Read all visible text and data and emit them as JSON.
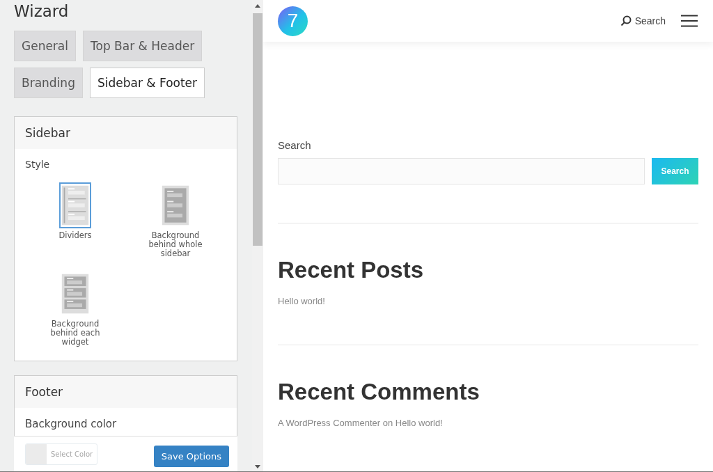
{
  "wizard": {
    "title": "Wizard",
    "tabs": [
      {
        "label": "General",
        "selected": false
      },
      {
        "label": "Top Bar & Header",
        "selected": false
      },
      {
        "label": "Branding",
        "selected": false
      },
      {
        "label": "Sidebar & Footer",
        "selected": true
      }
    ],
    "sidebar": {
      "title": "Sidebar",
      "style_label": "Style",
      "options": [
        {
          "kind": "dividers",
          "label": "Dividers",
          "selected": true
        },
        {
          "kind": "whole",
          "label": "Background behind whole sidebar",
          "selected": false
        },
        {
          "kind": "widget",
          "label": "Background behind each widget",
          "selected": false
        }
      ]
    },
    "footer": {
      "title": "Footer",
      "background_label": "Background color"
    },
    "color_picker": {
      "label": "Select Color"
    },
    "save_button": "Save Options"
  },
  "preview": {
    "logo": "7",
    "header_search": "Search",
    "search_widget": {
      "title": "Search",
      "button": "Search"
    },
    "recent_posts": {
      "title": "Recent Posts",
      "items": [
        "Hello world!"
      ]
    },
    "recent_comments": {
      "title": "Recent Comments",
      "items": [
        "A WordPress Commenter on Hello world!"
      ]
    }
  }
}
